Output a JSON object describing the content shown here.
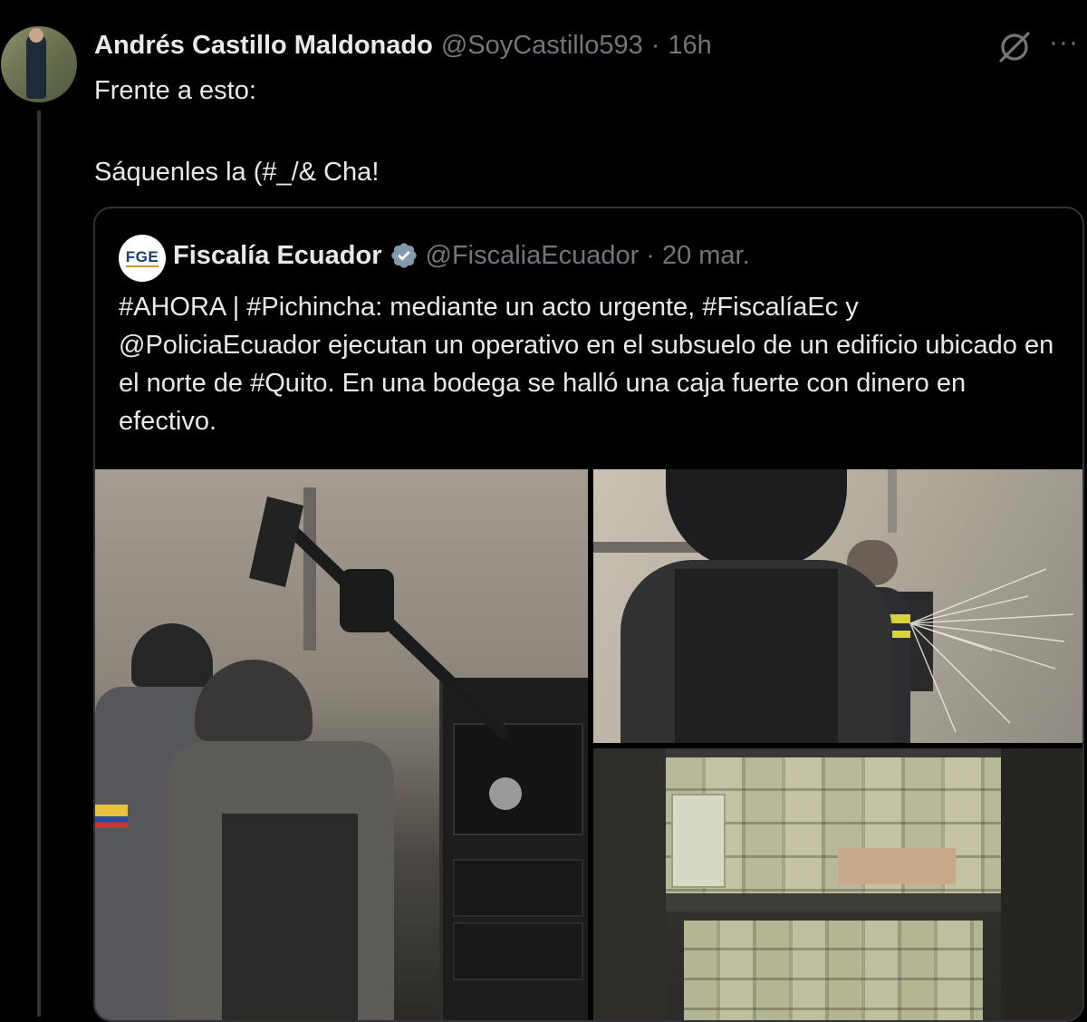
{
  "tweet": {
    "author_name": "Andrés Castillo Maldonado",
    "author_handle": "@SoyCastillo593",
    "separator": "·",
    "time": "16h",
    "text_line_1": "Frente a esto:",
    "text_line_2": "Sáquenles la (#_/& Cha!",
    "more_label": "···"
  },
  "quoted_tweet": {
    "avatar_text": "FGE",
    "author_name": "Fiscalía Ecuador",
    "author_handle": "@FiscaliaEcuador",
    "separator": "·",
    "time": "20 mar.",
    "text": "#AHORA | #Pichincha: mediante un acto urgente, #FiscalíaEc y @PoliciaEcuador ejecutan un operativo en el subsuelo de un edificio ubicado en el norte de #Quito. En una bodega se halló una caja fuerte con dinero en efectivo.",
    "media": [
      {
        "icon": "photo-police-breaking-safe"
      },
      {
        "icon": "photo-police-cutting-safe"
      },
      {
        "icon": "photo-cash-in-safe"
      }
    ]
  },
  "colors": {
    "background": "#000000",
    "text_primary": "#e7e9ea",
    "text_secondary": "#71767b",
    "border": "#2f3336",
    "verified_gray": "#829aab"
  }
}
